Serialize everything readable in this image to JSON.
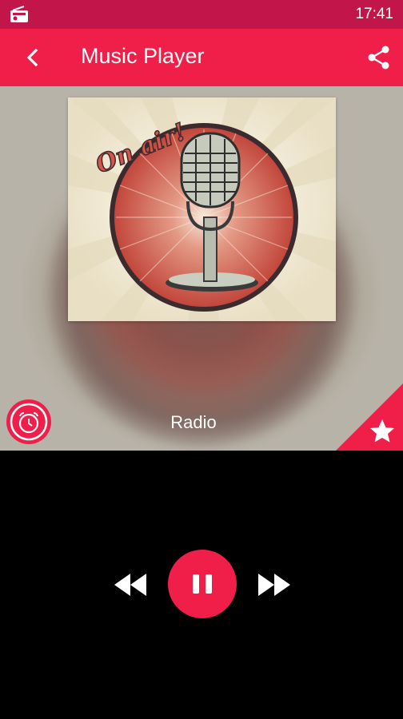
{
  "status_bar": {
    "time": "17:41",
    "left_icon": "radio-icon"
  },
  "app_bar": {
    "back_icon": "chevron-left-icon",
    "title": "Music Player",
    "share_icon": "share-icon"
  },
  "player": {
    "station_name": "Radio",
    "album_art_text": "On air!",
    "alarm_icon": "alarm-clock-icon",
    "favorite_icon": "star-icon"
  },
  "controls": {
    "rewind_icon": "rewind-icon",
    "play_pause_icon": "pause-icon",
    "forward_icon": "fast-forward-icon"
  },
  "colors": {
    "status_bar": "#c2154a",
    "accent": "#ef1f4a",
    "background": "#000000"
  }
}
